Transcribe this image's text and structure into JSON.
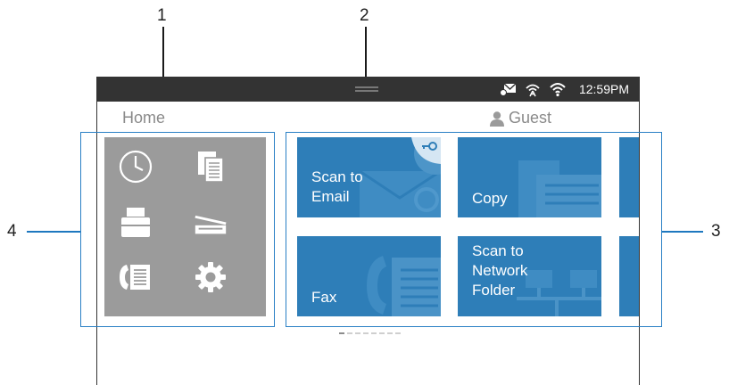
{
  "callouts": {
    "n1": "1",
    "n2": "2",
    "n3": "3",
    "n4": "4"
  },
  "status_bar": {
    "time": "12:59PM",
    "icons": [
      "job-status-icon",
      "wireless-direct-icon",
      "wifi-icon"
    ]
  },
  "header": {
    "home_label": "Home",
    "user_label": "Guest",
    "user_icon": "person-icon"
  },
  "apps_panel": {
    "icons": [
      "job-status-icon",
      "copy-settings-icon",
      "printer-icon",
      "scanner-icon",
      "fax-address-book-icon",
      "settings-gear-icon"
    ]
  },
  "tiles": {
    "scan_to_email": "Scan to\nEmail",
    "copy": "Copy",
    "fax": "Fax",
    "scan_to_network_folder": "Scan to\nNetwork\nFolder"
  },
  "pagination": {
    "count": 8,
    "active": 0
  },
  "colors": {
    "status_bar": "#333333",
    "tile": "#2e7eb8",
    "frame": "#2a80c5",
    "panel": "#9b9b9b"
  }
}
